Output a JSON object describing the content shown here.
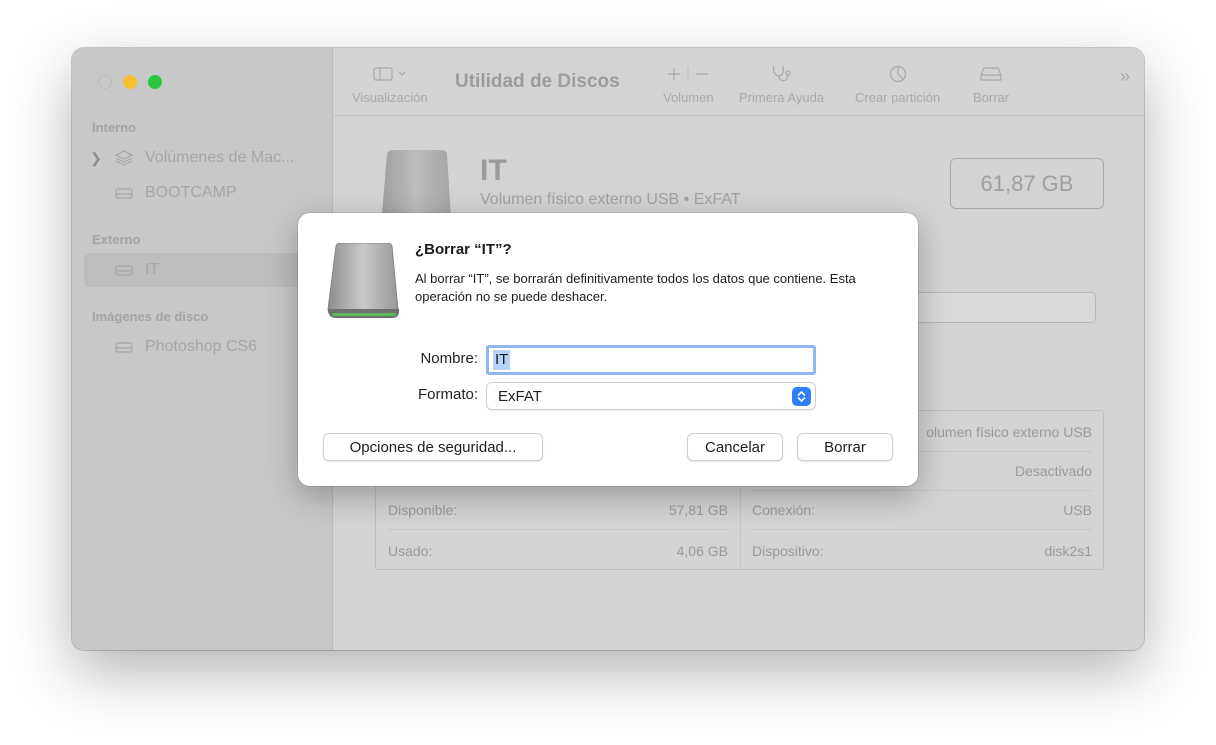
{
  "window": {
    "traffic_lights": [
      "close",
      "minimize",
      "maximize"
    ]
  },
  "sidebar": {
    "sections": [
      {
        "title": "Interno"
      },
      {
        "title": "Externo"
      },
      {
        "title": "Imágenes de disco"
      }
    ],
    "items": [
      {
        "label": "Volúmenes de Mac...",
        "icon": "layers-icon"
      },
      {
        "label": "BOOTCAMP",
        "icon": "drive-icon"
      },
      {
        "label": "IT",
        "icon": "drive-icon",
        "selected": true
      },
      {
        "label": "Photoshop CS6",
        "icon": "drive-icon"
      }
    ]
  },
  "toolbar": {
    "view_label": "Visualización",
    "title": "Utilidad de Discos",
    "volume_label": "Volumen",
    "first_aid_label": "Primera Ayuda",
    "partition_label": "Crear partición",
    "erase_label": "Borrar",
    "more": "»"
  },
  "volume": {
    "name": "IT",
    "description": "Volumen físico externo USB • ExFAT",
    "capacity": "61,87 GB"
  },
  "info": {
    "left": [
      {
        "label": "Disponible:",
        "value": "57,81 GB"
      },
      {
        "label": "Usado:",
        "value": "4,06 GB"
      }
    ],
    "right": [
      {
        "label": "",
        "value": "olumen físico externo USB"
      },
      {
        "label": "",
        "value": "Desactivado"
      },
      {
        "label": "Conexión:",
        "value": "USB"
      },
      {
        "label": "Dispositivo:",
        "value": "disk2s1"
      }
    ]
  },
  "dialog": {
    "title": "¿Borrar “IT”?",
    "message": "Al borrar “IT”, se borrarán definitivamente todos los datos que contiene. Esta operación no se puede deshacer.",
    "name_label": "Nombre:",
    "name_value": "IT",
    "format_label": "Formato:",
    "format_value": "ExFAT",
    "security_button": "Opciones de seguridad...",
    "cancel_button": "Cancelar",
    "erase_button": "Borrar"
  },
  "colors": {
    "accent": "#2d7ef7",
    "focus_ring": "#8fb8f2",
    "selection": "#b4d3fb",
    "traffic_minimize": "#f5bf2e",
    "traffic_maximize": "#2ac83f"
  }
}
